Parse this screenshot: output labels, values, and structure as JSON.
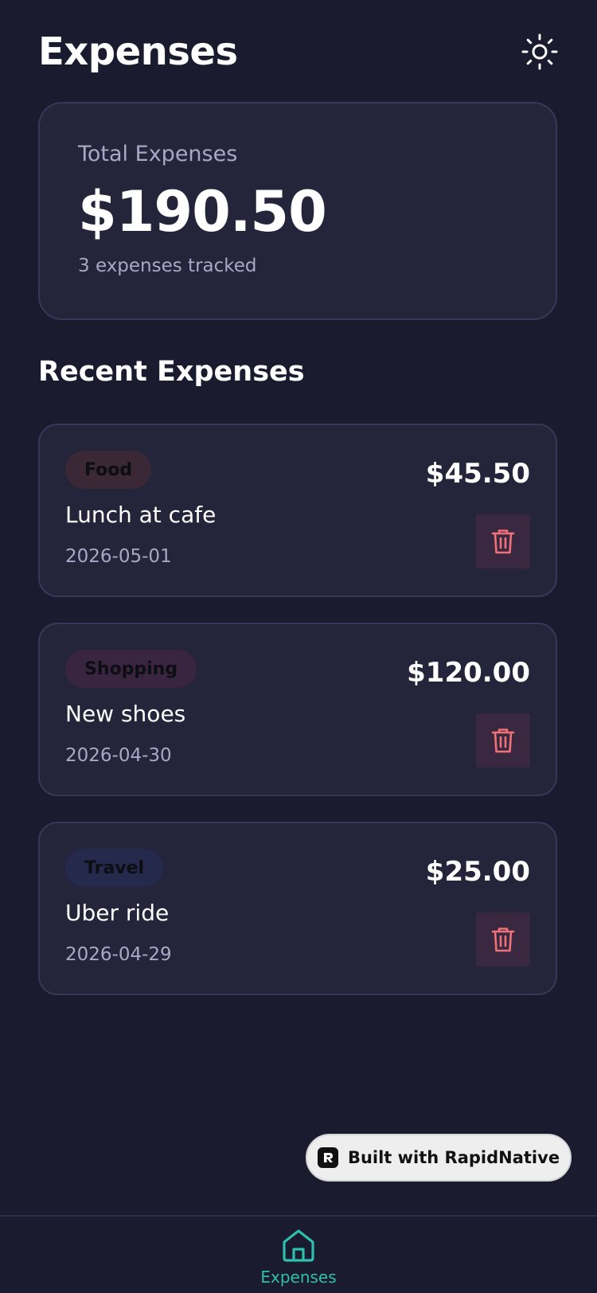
{
  "header": {
    "title": "Expenses",
    "theme_icon": "sun-icon"
  },
  "summary": {
    "label": "Total Expenses",
    "total": "$190.50",
    "count_text": "3 expenses tracked"
  },
  "recent": {
    "title": "Recent Expenses",
    "items": [
      {
        "category": "Food",
        "category_color": "#3a2837",
        "description": "Lunch at cafe",
        "date": "2026-05-01",
        "amount": "$45.50"
      },
      {
        "category": "Shopping",
        "category_color": "#3a2540",
        "description": "New shoes",
        "date": "2026-04-30",
        "amount": "$120.00"
      },
      {
        "category": "Travel",
        "category_color": "#252a4d",
        "description": "Uber ride",
        "date": "2026-04-29",
        "amount": "$25.00"
      }
    ]
  },
  "badge": {
    "text": "Built with RapidNative"
  },
  "tabs": [
    {
      "label": "Expenses",
      "icon": "home-icon",
      "active": true
    }
  ],
  "colors": {
    "background": "#1b1b2f",
    "card": "#24243b",
    "accent": "#2fbfae",
    "delete": "#f07178"
  }
}
